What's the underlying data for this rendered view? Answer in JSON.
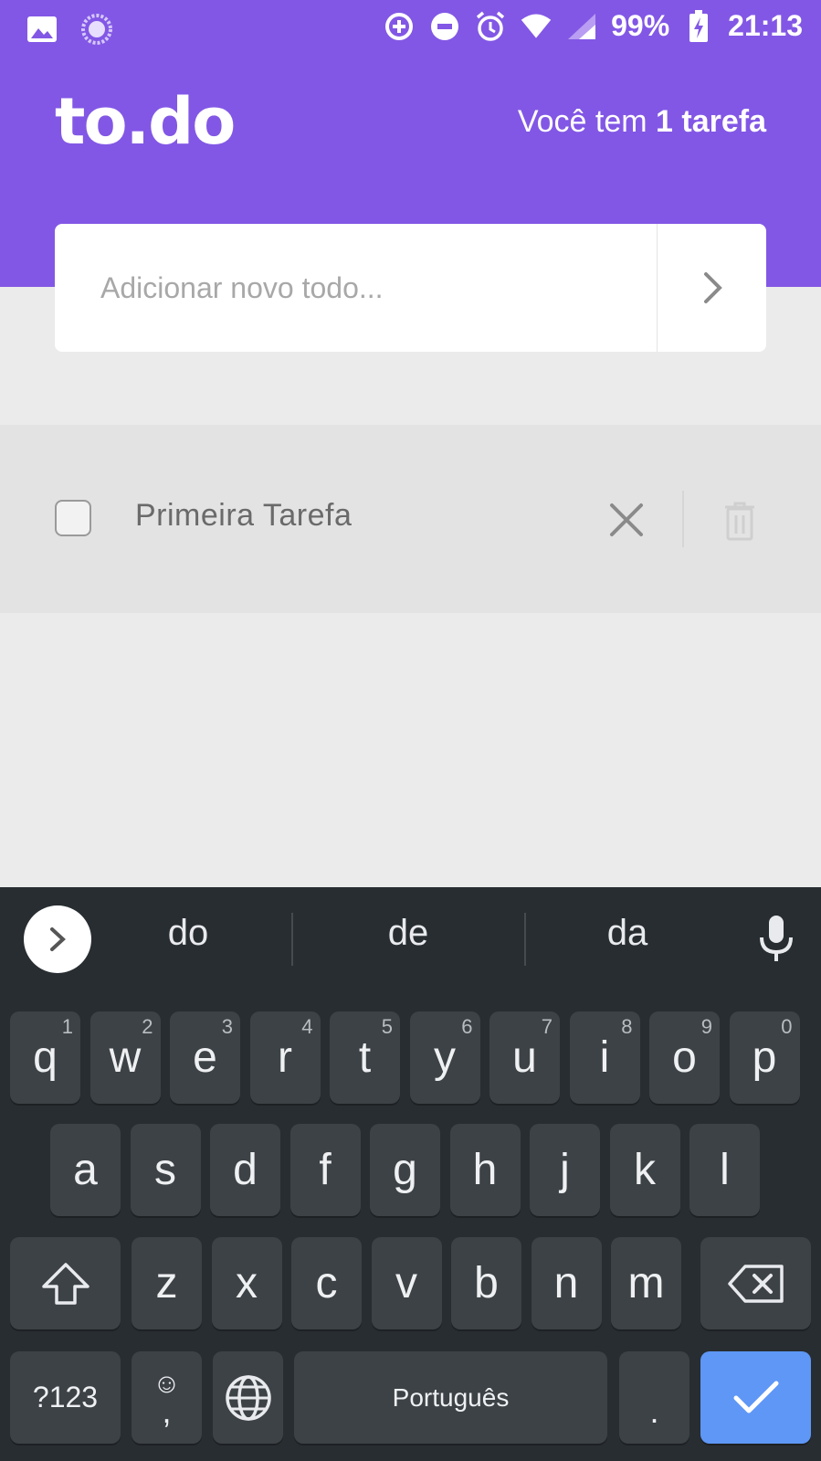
{
  "status_bar": {
    "battery": "99%",
    "time": "21:13",
    "icons": [
      "image-icon",
      "sync-icon",
      "data-saver-icon",
      "do-not-disturb-icon",
      "alarm-icon",
      "wifi-icon",
      "signal-icon",
      "battery-charging-icon"
    ]
  },
  "header": {
    "logo": "to.do",
    "summary_prefix": "Você tem ",
    "summary_count": "1 tarefa",
    "background": "#8257e5"
  },
  "new_todo": {
    "placeholder": "Adicionar novo todo...",
    "value": ""
  },
  "tasks": [
    {
      "title": "Primeira Tarefa",
      "done": false
    }
  ],
  "keyboard": {
    "suggestions": [
      "do",
      "de",
      "da"
    ],
    "row1": [
      {
        "key": "q",
        "hint": "1"
      },
      {
        "key": "w",
        "hint": "2"
      },
      {
        "key": "e",
        "hint": "3"
      },
      {
        "key": "r",
        "hint": "4"
      },
      {
        "key": "t",
        "hint": "5"
      },
      {
        "key": "y",
        "hint": "6"
      },
      {
        "key": "u",
        "hint": "7"
      },
      {
        "key": "i",
        "hint": "8"
      },
      {
        "key": "o",
        "hint": "9"
      },
      {
        "key": "p",
        "hint": "0"
      }
    ],
    "row2": [
      "a",
      "s",
      "d",
      "f",
      "g",
      "h",
      "j",
      "k",
      "l"
    ],
    "row3": [
      "z",
      "x",
      "c",
      "v",
      "b",
      "n",
      "m"
    ],
    "symbols_label": "?123",
    "emoji_label": "☺",
    "comma_label": ",",
    "space_label": "Português",
    "period_label": ".",
    "accent": "#5e97f6"
  }
}
